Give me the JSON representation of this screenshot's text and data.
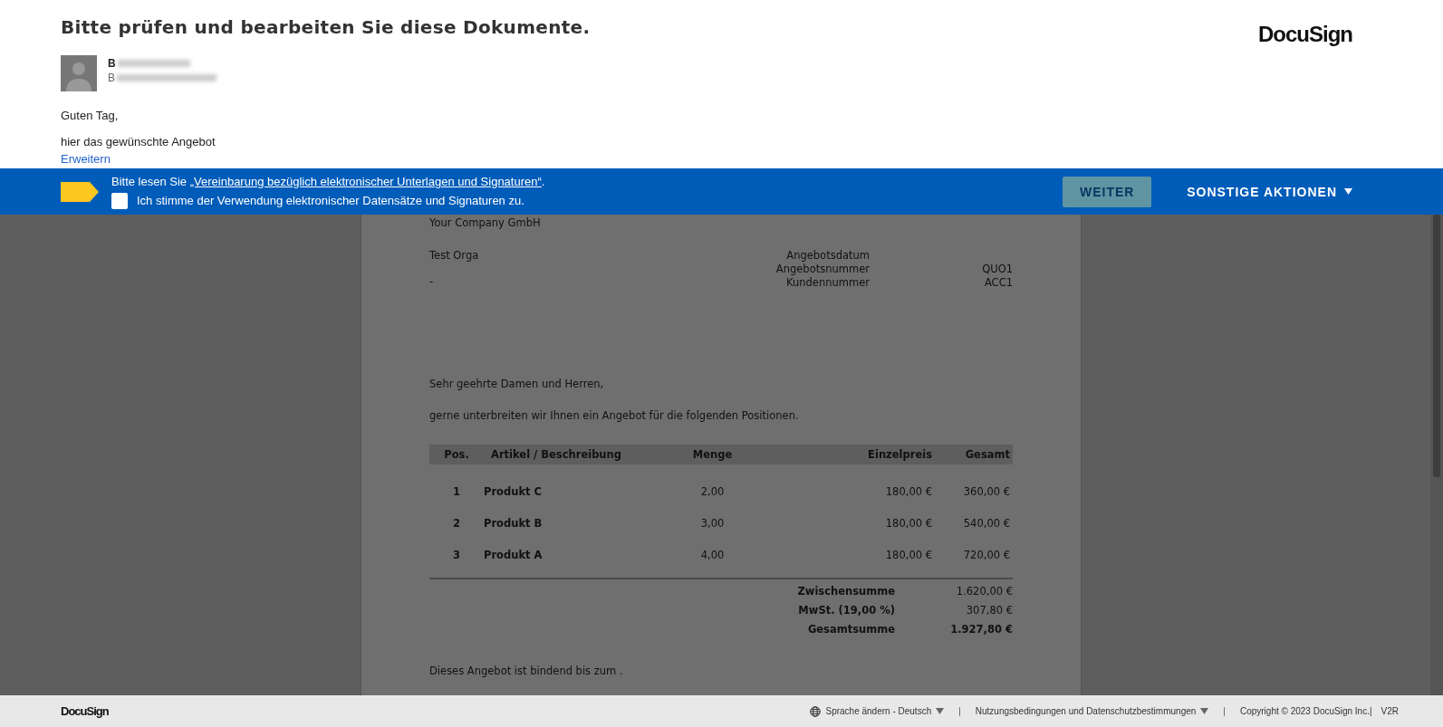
{
  "header": {
    "title": "Bitte prüfen und bearbeiten Sie diese Dokumente.",
    "logo": "DocuSign",
    "sender": {
      "name": "B",
      "company": "B"
    },
    "message": [
      "Guten Tag,",
      "hier das gewünschte Angebot"
    ],
    "expand_link": "Erweitern"
  },
  "banner": {
    "text_before": "Bitte lesen Sie ",
    "link": "„Vereinbarung bezüglich elektronischer Unterlagen und Signaturen“",
    "text_after": ".",
    "consent": {
      "label": "Ich stimme der Verwendung elektronischer Datensätze und Signaturen zu.",
      "checked": false
    },
    "continue_button": {
      "label": "WEITER",
      "disabled": true
    },
    "more_actions": "SONSTIGE AKTIONEN"
  },
  "document": {
    "company_line": "Your Company GmbH",
    "recipient": [
      "Test Orga",
      "-"
    ],
    "meta": [
      {
        "label": "Angebotsdatum"
      },
      {
        "label": "Angebotsnummer",
        "value": "QUO1"
      },
      {
        "label": "Kundennummer",
        "value": "ACC1"
      }
    ],
    "salutation": "Sehr geehrte Damen und Herren,",
    "intro": "gerne unterbreiten wir Ihnen ein Angebot für die folgenden Positionen.",
    "table": {
      "columns": [
        "Pos.",
        "Artikel / Beschreibung",
        "Menge",
        "Einzelpreis",
        "Gesamt"
      ],
      "rows": [
        [
          "1",
          "Produkt C",
          "2,00",
          "180,00 €",
          "360,00 €"
        ],
        [
          "2",
          "Produkt B",
          "3,00",
          "180,00 €",
          "540,00 €"
        ],
        [
          "3",
          "Produkt A",
          "4,00",
          "180,00 €",
          "720,00 €"
        ]
      ]
    },
    "totals": [
      {
        "label": "Zwischensumme",
        "value": "1.620,00 €",
        "bold": false
      },
      {
        "label": "MwSt. (19,00 %)",
        "value": "307,80 €",
        "bold": false
      },
      {
        "label": "Gesamtsumme",
        "value": "1.927,80 €",
        "bold": true
      }
    ],
    "closing": "Dieses Angebot ist bindend bis zum ."
  },
  "footer": {
    "logo": "DocuSign",
    "language": "Sprache ändern - Deutsch",
    "terms": "Nutzungsbedingungen und Datenschutzbestimmungen",
    "separator": "|",
    "copyright": "Copyright © 2023 DocuSign Inc.|",
    "version": "V2R"
  }
}
